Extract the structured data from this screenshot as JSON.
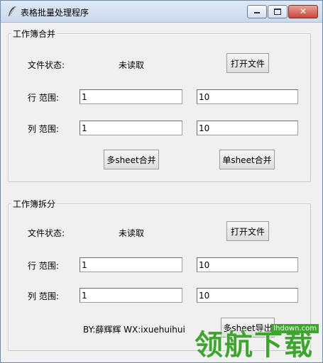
{
  "window": {
    "title": "表格批量处理程序",
    "controls": {
      "minimize_icon": "minimize-icon",
      "maximize_icon": "maximize-icon",
      "close_icon": "close-icon"
    }
  },
  "merge": {
    "title": "工作簿合并",
    "file_status_label": "文件状态:",
    "file_status_value": "未读取",
    "open_button": "打开文件",
    "row_label": "行  范围:",
    "row_start": "1",
    "row_end": "10",
    "col_label": "列  范围:",
    "col_start": "1",
    "col_end": "10",
    "multi_sheet_button": "多sheet合并",
    "single_sheet_button": "单sheet合并"
  },
  "split": {
    "title": "工作簿拆分",
    "file_status_label": "文件状态:",
    "file_status_value": "未读取",
    "open_button": "打开文件",
    "row_label": "行  范围:",
    "row_start": "1",
    "row_end": "10",
    "col_label": "列  范围:",
    "col_start": "1",
    "col_end": "10",
    "export_button": "多sheet导出",
    "credit": "BY:薛辉辉 WX:ixuehuihui"
  },
  "watermark": {
    "text": "领航下载",
    "tag": "lhdown.com"
  },
  "colors": {
    "watermark_green": "#3ea62f",
    "close_red": "#c9463a"
  }
}
